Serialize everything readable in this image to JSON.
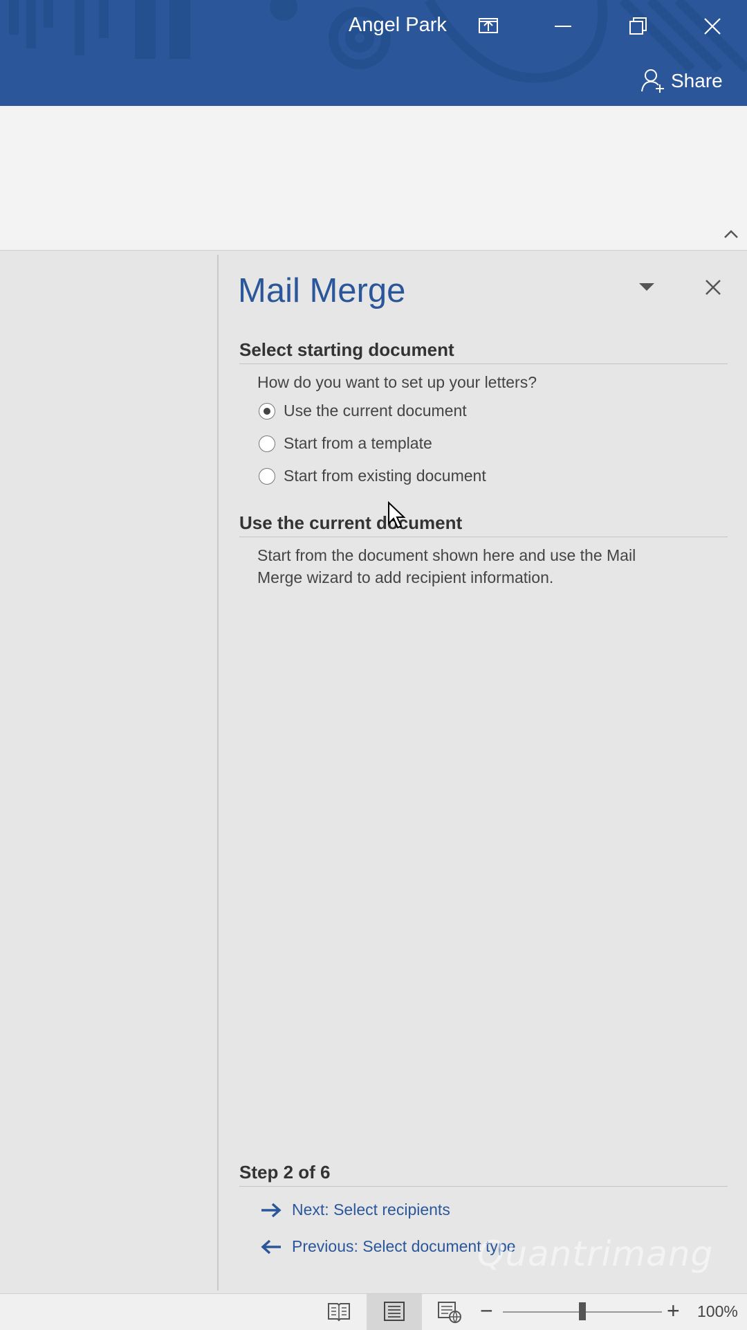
{
  "titlebar": {
    "user_name": "Angel Park",
    "share_label": "Share",
    "accent_color": "#2b579a"
  },
  "pane": {
    "title": "Mail Merge",
    "section1_title": "Select starting document",
    "question": "How do you want to set up your letters?",
    "options": [
      {
        "label": "Use the current document",
        "checked": true
      },
      {
        "label": "Start from a template",
        "checked": false
      },
      {
        "label": "Start from existing document",
        "checked": false
      }
    ],
    "section2_title": "Use the current document",
    "description_line1": "Start from the document shown here and use the Mail",
    "description_line2": "Merge wizard to add recipient information.",
    "step_label": "Step 2 of 6",
    "next_link": "Next: Select recipients",
    "previous_link": "Previous: Select document type"
  },
  "statusbar": {
    "zoom_percent": "100%",
    "zoom_level": 1.0
  },
  "watermark": "Quantrimang"
}
